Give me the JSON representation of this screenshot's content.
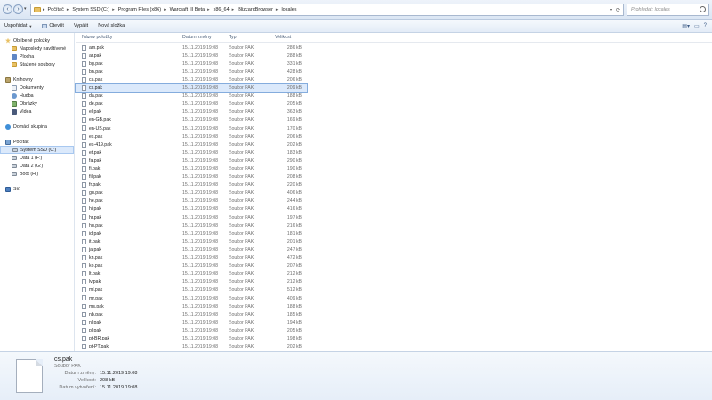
{
  "address_bar": {
    "crumbs": [
      "Počítač",
      "System SSD (C:)",
      "Program Files (x86)",
      "Warcraft III Beta",
      "x86_64",
      "BlizzardBrowser",
      "locales"
    ],
    "search_placeholder": "Prohledat: locales"
  },
  "toolbar": {
    "organize": "Uspořádat",
    "open": "Otevřít",
    "burn": "Vypálit",
    "new_folder": "Nová složka"
  },
  "sidebar": {
    "favorites": {
      "label": "Oblíbené položky",
      "items": [
        "Naposledy navštívené",
        "Plocha",
        "Stažené soubory"
      ]
    },
    "libraries": {
      "label": "Knihovny",
      "items": [
        "Dokumenty",
        "Hudba",
        "Obrázky",
        "Videa"
      ]
    },
    "homegroup": {
      "label": "Domácí skupina"
    },
    "computer": {
      "label": "Počítač",
      "items": [
        "System SSD (C:)",
        "Data 1 (F:)",
        "Data 2 (G:)",
        "Boot (H:)"
      ]
    },
    "network": {
      "label": "Síť"
    }
  },
  "columns": {
    "name": "Název položky",
    "date": "Datum změny",
    "type": "Typ",
    "size": "Velikost"
  },
  "files": [
    {
      "name": "am.pak",
      "date": "15.11.2019 19:08",
      "type": "Soubor PAK",
      "size": "286 kB"
    },
    {
      "name": "ar.pak",
      "date": "15.11.2019 19:08",
      "type": "Soubor PAK",
      "size": "288 kB"
    },
    {
      "name": "bg.pak",
      "date": "15.11.2019 19:08",
      "type": "Soubor PAK",
      "size": "331 kB"
    },
    {
      "name": "bn.pak",
      "date": "15.11.2019 19:08",
      "type": "Soubor PAK",
      "size": "428 kB"
    },
    {
      "name": "ca.pak",
      "date": "15.11.2019 19:08",
      "type": "Soubor PAK",
      "size": "206 kB"
    },
    {
      "name": "cs.pak",
      "date": "15.11.2019 19:08",
      "type": "Soubor PAK",
      "size": "209 kB"
    },
    {
      "name": "da.pak",
      "date": "15.11.2019 19:08",
      "type": "Soubor PAK",
      "size": "188 kB"
    },
    {
      "name": "de.pak",
      "date": "15.11.2019 19:08",
      "type": "Soubor PAK",
      "size": "205 kB"
    },
    {
      "name": "el.pak",
      "date": "15.11.2019 19:08",
      "type": "Soubor PAK",
      "size": "363 kB"
    },
    {
      "name": "en-GB.pak",
      "date": "15.11.2019 19:08",
      "type": "Soubor PAK",
      "size": "169 kB"
    },
    {
      "name": "en-US.pak",
      "date": "15.11.2019 19:08",
      "type": "Soubor PAK",
      "size": "170 kB"
    },
    {
      "name": "es.pak",
      "date": "15.11.2019 19:08",
      "type": "Soubor PAK",
      "size": "206 kB"
    },
    {
      "name": "es-419.pak",
      "date": "15.11.2019 19:08",
      "type": "Soubor PAK",
      "size": "202 kB"
    },
    {
      "name": "et.pak",
      "date": "15.11.2019 19:08",
      "type": "Soubor PAK",
      "size": "183 kB"
    },
    {
      "name": "fa.pak",
      "date": "15.11.2019 19:08",
      "type": "Soubor PAK",
      "size": "290 kB"
    },
    {
      "name": "fi.pak",
      "date": "15.11.2019 19:08",
      "type": "Soubor PAK",
      "size": "190 kB"
    },
    {
      "name": "fil.pak",
      "date": "15.11.2019 19:08",
      "type": "Soubor PAK",
      "size": "208 kB"
    },
    {
      "name": "fr.pak",
      "date": "15.11.2019 19:08",
      "type": "Soubor PAK",
      "size": "220 kB"
    },
    {
      "name": "gu.pak",
      "date": "15.11.2019 19:08",
      "type": "Soubor PAK",
      "size": "406 kB"
    },
    {
      "name": "he.pak",
      "date": "15.11.2019 19:08",
      "type": "Soubor PAK",
      "size": "244 kB"
    },
    {
      "name": "hi.pak",
      "date": "15.11.2019 19:08",
      "type": "Soubor PAK",
      "size": "416 kB"
    },
    {
      "name": "hr.pak",
      "date": "15.11.2019 19:08",
      "type": "Soubor PAK",
      "size": "197 kB"
    },
    {
      "name": "hu.pak",
      "date": "15.11.2019 19:08",
      "type": "Soubor PAK",
      "size": "216 kB"
    },
    {
      "name": "id.pak",
      "date": "15.11.2019 19:08",
      "type": "Soubor PAK",
      "size": "181 kB"
    },
    {
      "name": "it.pak",
      "date": "15.11.2019 19:08",
      "type": "Soubor PAK",
      "size": "201 kB"
    },
    {
      "name": "ja.pak",
      "date": "15.11.2019 19:08",
      "type": "Soubor PAK",
      "size": "247 kB"
    },
    {
      "name": "kn.pak",
      "date": "15.11.2019 19:08",
      "type": "Soubor PAK",
      "size": "472 kB"
    },
    {
      "name": "ko.pak",
      "date": "15.11.2019 19:08",
      "type": "Soubor PAK",
      "size": "207 kB"
    },
    {
      "name": "lt.pak",
      "date": "15.11.2019 19:08",
      "type": "Soubor PAK",
      "size": "212 kB"
    },
    {
      "name": "lv.pak",
      "date": "15.11.2019 19:08",
      "type": "Soubor PAK",
      "size": "212 kB"
    },
    {
      "name": "ml.pak",
      "date": "15.11.2019 19:08",
      "type": "Soubor PAK",
      "size": "512 kB"
    },
    {
      "name": "mr.pak",
      "date": "15.11.2019 19:08",
      "type": "Soubor PAK",
      "size": "409 kB"
    },
    {
      "name": "ms.pak",
      "date": "15.11.2019 19:08",
      "type": "Soubor PAK",
      "size": "188 kB"
    },
    {
      "name": "nb.pak",
      "date": "15.11.2019 19:08",
      "type": "Soubor PAK",
      "size": "185 kB"
    },
    {
      "name": "nl.pak",
      "date": "15.11.2019 19:08",
      "type": "Soubor PAK",
      "size": "194 kB"
    },
    {
      "name": "pl.pak",
      "date": "15.11.2019 19:08",
      "type": "Soubor PAK",
      "size": "205 kB"
    },
    {
      "name": "pt-BR.pak",
      "date": "15.11.2019 19:08",
      "type": "Soubor PAK",
      "size": "198 kB"
    },
    {
      "name": "pt-PT.pak",
      "date": "15.11.2019 19:08",
      "type": "Soubor PAK",
      "size": "202 kB"
    }
  ],
  "selected_index": 5,
  "details": {
    "name": "cs.pak",
    "type": "Soubor PAK",
    "rows": [
      {
        "label": "Datum změny:",
        "value": "15.11.2019 19:08"
      },
      {
        "label": "Velikost:",
        "value": "208 kB"
      },
      {
        "label": "Datum vytvoření:",
        "value": "15.11.2019 19:08"
      }
    ]
  },
  "colors": {
    "selection": "#dbe9fb",
    "selection_border": "#84acdd",
    "chrome": "#e3ecf7"
  },
  "icons": {
    "back": "back-arrow-icon",
    "forward": "forward-arrow-icon",
    "search": "search-icon",
    "file": "file-icon",
    "folder": "folder-icon"
  }
}
